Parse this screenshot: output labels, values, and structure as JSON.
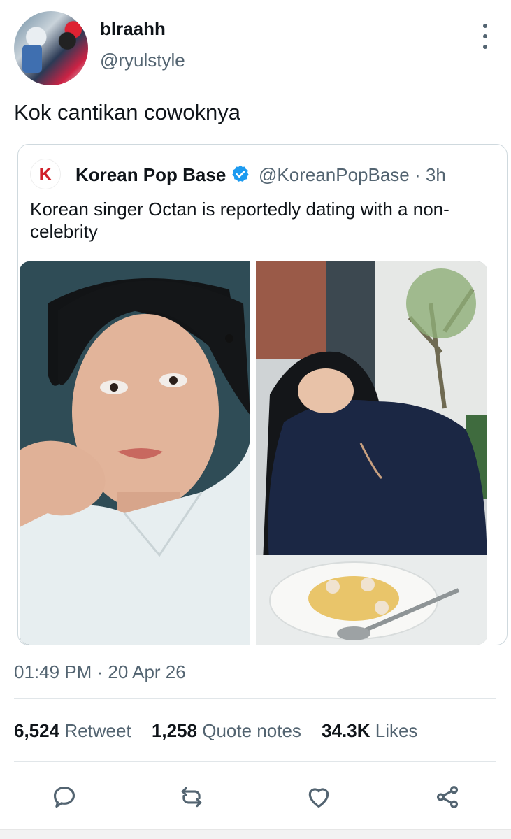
{
  "tweet": {
    "display_name": "blraahh",
    "handle": "@ryulstyle",
    "text": "Kok cantikan cowoknya",
    "timestamp": "01:49 PM · 20 Apr 26"
  },
  "quote": {
    "logo_letter": "K",
    "name": "Korean Pop Base",
    "handle_time": "@KoreanPopBase · 3h",
    "text": "Korean singer Octan is reportedly dating with a non-celebrity"
  },
  "stats": {
    "retweets_count": "6,524",
    "retweets_label": "Retweet",
    "quotes_count": "1,258",
    "quotes_label": "Quote notes",
    "likes_count": "34.3K",
    "likes_label": "Likes"
  },
  "colors": {
    "text_primary": "#0f1419",
    "text_secondary": "#536471",
    "verified": "#1d9bf0",
    "logo_red": "#d0202a",
    "border": "#cfd9de"
  },
  "icons": [
    "more-vertical-icon",
    "verified-badge-icon",
    "reply-icon",
    "retweet-icon",
    "like-icon",
    "share-icon"
  ]
}
